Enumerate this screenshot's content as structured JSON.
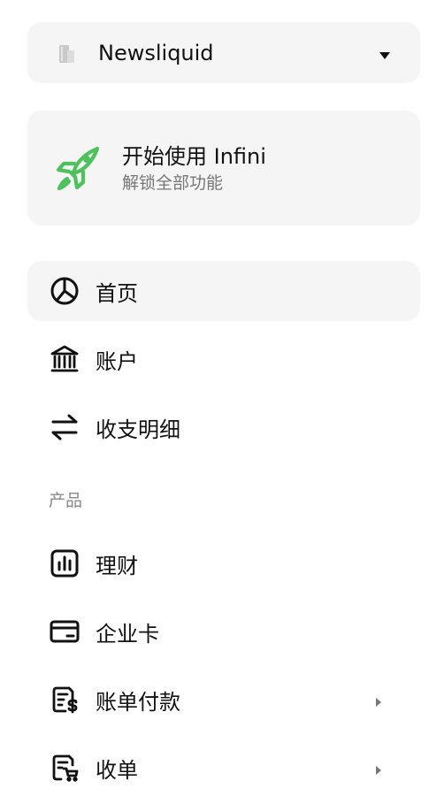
{
  "org_switcher": {
    "name": "Newsliquid",
    "icon": "building-icon",
    "caret_icon": "caret-down-icon"
  },
  "onboarding_card": {
    "title": "开始使用 Infini",
    "subtitle": "解锁全部功能",
    "icon": "rocket-icon",
    "accent_color": "#4cc35a"
  },
  "nav": {
    "main_items": [
      {
        "label": "首页",
        "icon": "pie-chart-icon",
        "active": true
      },
      {
        "label": "账户",
        "icon": "bank-icon",
        "active": false
      },
      {
        "label": "收支明细",
        "icon": "transfer-arrows-icon",
        "active": false
      }
    ],
    "section_products_label": "产品",
    "product_items": [
      {
        "label": "理财",
        "icon": "bar-chart-icon",
        "has_submenu": false
      },
      {
        "label": "企业卡",
        "icon": "credit-card-icon",
        "has_submenu": false
      },
      {
        "label": "账单付款",
        "icon": "bill-dollar-icon",
        "has_submenu": true
      },
      {
        "label": "收单",
        "icon": "receipt-cart-icon",
        "has_submenu": true
      }
    ]
  },
  "colors": {
    "card_background": "#f5f5f5",
    "text_primary": "#111111",
    "text_secondary": "#777777"
  }
}
